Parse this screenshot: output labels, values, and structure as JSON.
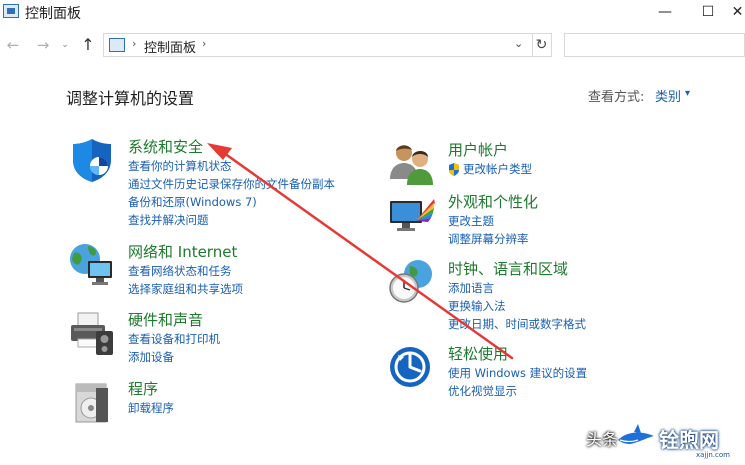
{
  "window": {
    "title": "控制面板",
    "minimize_glyph": "—",
    "maximize_glyph": "☐",
    "close_glyph": "✕"
  },
  "address": {
    "crumb": "控制面板",
    "separator": "›",
    "back_glyph": "←",
    "forward_glyph": "→",
    "recent_glyph": "⌄",
    "up_glyph": "↑",
    "dropdown_glyph": "⌄",
    "refresh_glyph": "↻"
  },
  "main": {
    "heading": "调整计算机的设置",
    "view_by_label": "查看方式:",
    "view_by_value": "类别",
    "view_by_caret": "▾"
  },
  "categories": {
    "system": {
      "title": "系统和安全",
      "links": [
        "查看你的计算机状态",
        "通过文件历史记录保存你的文件备份副本",
        "备份和还原(Windows 7)",
        "查找并解决问题"
      ]
    },
    "network": {
      "title": "网络和 Internet",
      "links": [
        "查看网络状态和任务",
        "选择家庭组和共享选项"
      ]
    },
    "hardware": {
      "title": "硬件和声音",
      "links": [
        "查看设备和打印机",
        "添加设备"
      ]
    },
    "programs": {
      "title": "程序",
      "links": [
        "卸载程序"
      ]
    },
    "user": {
      "title": "用户帐户",
      "links": [
        "更改帐户类型"
      ]
    },
    "appearance": {
      "title": "外观和个性化",
      "links": [
        "更改主题",
        "调整屏幕分辨率"
      ]
    },
    "clock": {
      "title": "时钟、语言和区域",
      "links": [
        "添加语言",
        "更换输入法",
        "更改日期、时间或数字格式"
      ]
    },
    "ease": {
      "title": "轻松使用",
      "links": [
        "使用 Windows 建议的设置",
        "优化视觉显示"
      ]
    }
  },
  "watermark": {
    "source": "头条",
    "site": "铨煦网",
    "url": "xajjn.com"
  },
  "colors": {
    "link": "#1a5fb4",
    "category_title": "#1e7a2e",
    "arrow": "#e53935"
  },
  "icons": {
    "app": "control-panel-icon",
    "system": "shield-icon",
    "network": "network-globe-icon",
    "hardware": "printer-icon",
    "programs": "programs-box-icon",
    "user": "users-icon",
    "appearance": "display-palette-icon",
    "clock": "clock-globe-icon",
    "ease": "ease-of-access-icon",
    "admin": "uac-shield-icon"
  }
}
